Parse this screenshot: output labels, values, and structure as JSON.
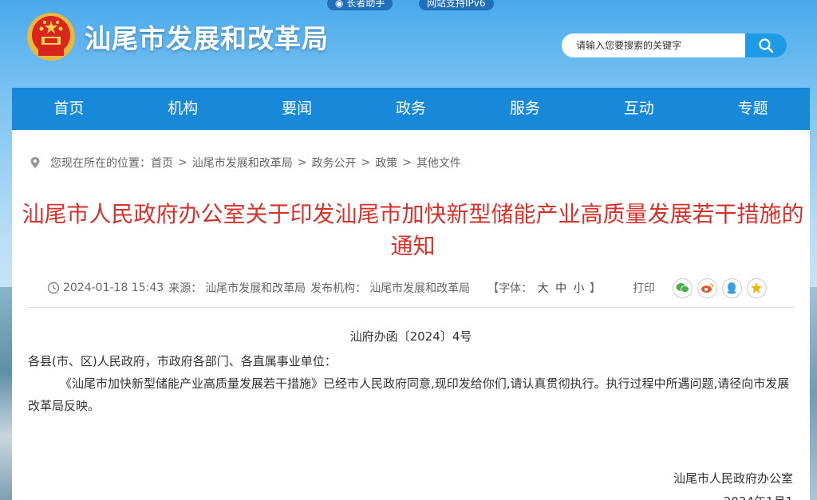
{
  "topbar": {
    "elder_assist": "长者助手",
    "ipv6": "网站支持IPv6"
  },
  "header": {
    "site_title": "汕尾市发展和改革局",
    "emblem_icon": "national-emblem-icon"
  },
  "search": {
    "placeholder": "请输入您要搜索的关键字",
    "button_icon": "search-icon"
  },
  "nav": {
    "items": [
      "首页",
      "机构",
      "要闻",
      "政务",
      "服务",
      "互动",
      "专题"
    ]
  },
  "breadcrumb": {
    "prefix": "您现在所在的位置：",
    "items": [
      "首页",
      "汕尾市发展和改革局",
      "政务公开",
      "政策",
      "其他文件"
    ],
    "separator": ">"
  },
  "article": {
    "title": "汕尾市人民政府办公室关于印发汕尾市加快新型储能产业高质量发展若干措施的通知",
    "datetime": "2024-01-18 15:43",
    "source_label": "来源：",
    "source": "汕尾市发展和改革局",
    "publisher_label": "发布机构：",
    "publisher": "汕尾市发展和改革局",
    "font_label": "【字体：",
    "font_large": "大",
    "font_medium": "中",
    "font_small": "小",
    "font_end": "】",
    "print": "打印",
    "doc_number": "汕府办函〔2024〕4号",
    "salutation": "各县(市、区)人民政府，市政府各部门、各直属事业单位：",
    "paragraph": "《汕尾市加快新型储能产业高质量发展若干措施》已经市人民政府同意,现印发给你们,请认真贯彻执行。执行过程中所遇问题,请径向市发展改革局反映。",
    "signature": "汕尾市人民政府办公室",
    "date_partial": "2024年1月1"
  },
  "colors": {
    "nav_bg": "#1789d8",
    "title_red": "#d5322c",
    "search_btn": "#1e9be4"
  }
}
